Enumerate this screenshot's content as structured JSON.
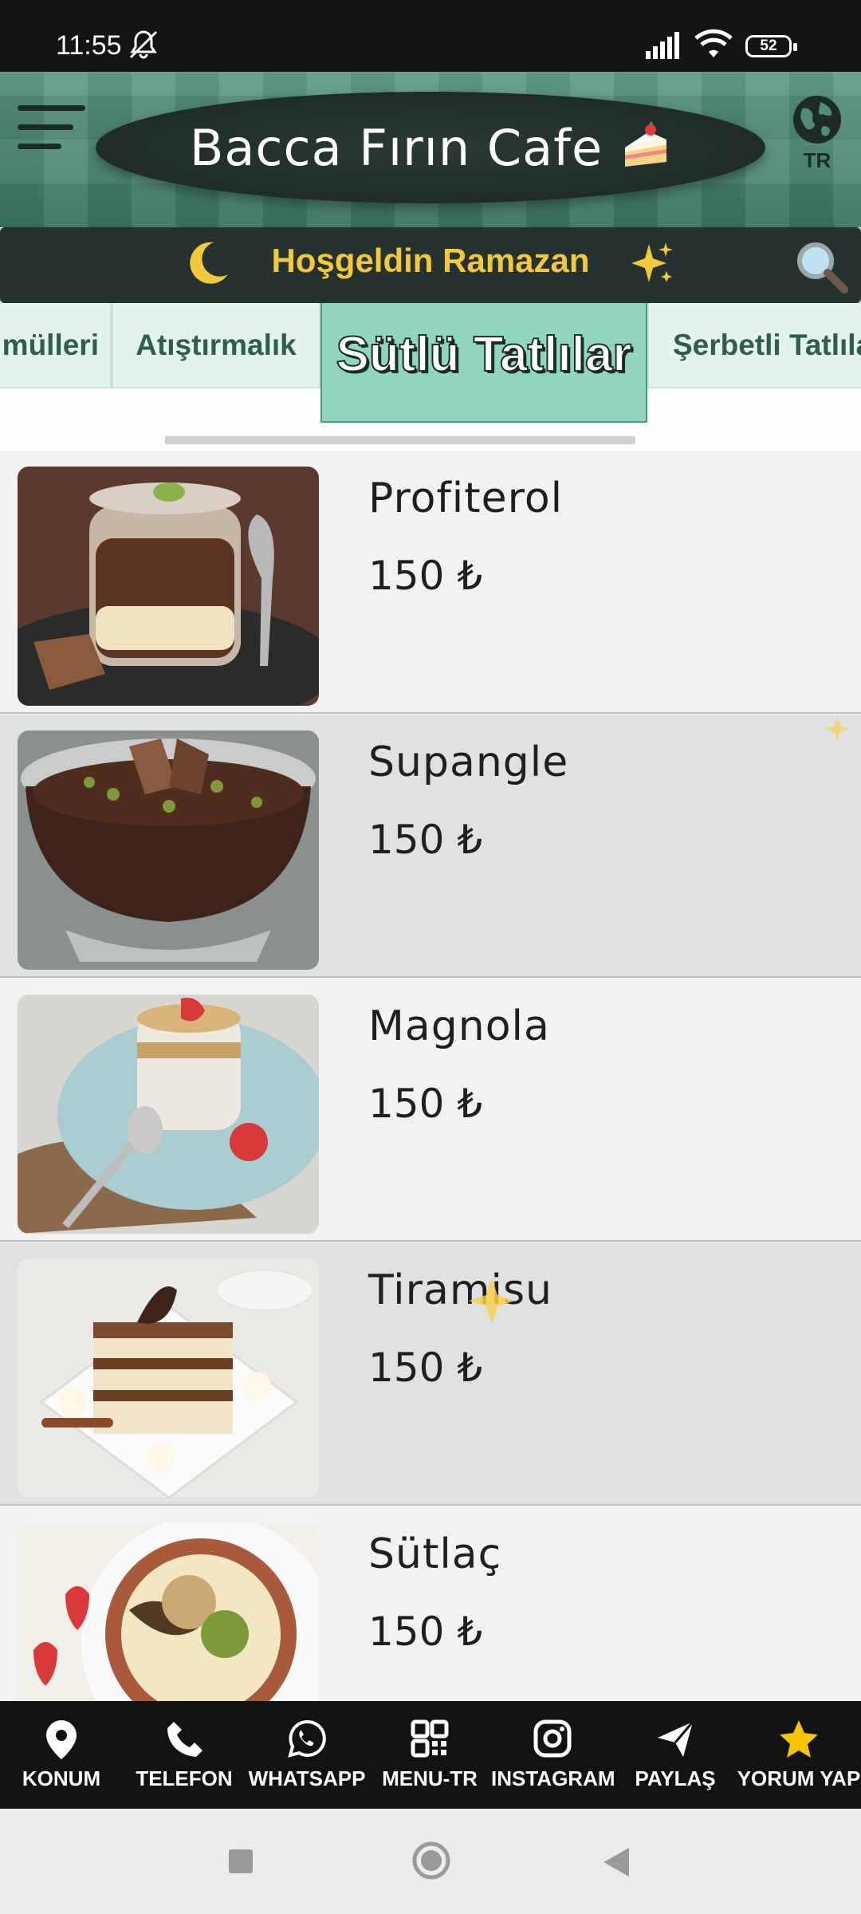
{
  "status_bar": {
    "time": "11:55",
    "battery": "52"
  },
  "header": {
    "title": "Bacca Fırın Cafe",
    "language_code": "TR"
  },
  "banner": {
    "message": "Hoşgeldin Ramazan"
  },
  "tabs": [
    {
      "label": "mülleri"
    },
    {
      "label": "Atıştırmalık"
    },
    {
      "label": "Sütlü Tatlılar",
      "active": true
    },
    {
      "label": "Şerbetli Tatlılar"
    }
  ],
  "products": [
    {
      "name": "Profiterol",
      "price": "150 ₺"
    },
    {
      "name": "Supangle",
      "price": "150 ₺"
    },
    {
      "name": "Magnola",
      "price": "150 ₺"
    },
    {
      "name": "Tiramisu",
      "price": "150 ₺"
    },
    {
      "name": "Sütlaç",
      "price": "150 ₺"
    }
  ],
  "bottom_nav": [
    {
      "label": "KONUM",
      "icon": "location-pin-icon"
    },
    {
      "label": "TELEFON",
      "icon": "phone-icon"
    },
    {
      "label": "WHATSAPP",
      "icon": "whatsapp-icon"
    },
    {
      "label": "MENU-TR",
      "icon": "qr-code-icon"
    },
    {
      "label": "INSTAGRAM",
      "icon": "instagram-icon"
    },
    {
      "label": "PAYLAŞ",
      "icon": "share-icon"
    },
    {
      "label": "YORUM YAP",
      "icon": "star-icon"
    }
  ],
  "colors": {
    "header_green": "#4f8c77",
    "banner_dark": "#26322f",
    "banner_text": "#f2c93a",
    "active_tab": "#8fd6bd",
    "tab_bg": "#e3f3ee",
    "nav_bg": "#121212",
    "star": "#f6c500"
  }
}
